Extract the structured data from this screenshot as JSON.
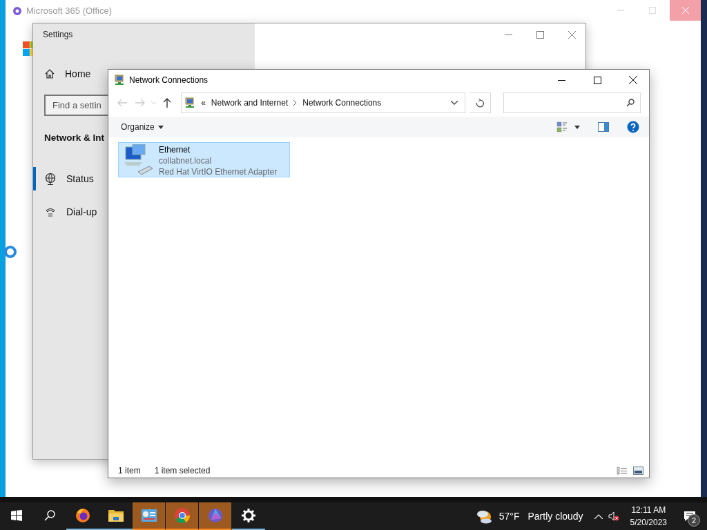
{
  "office_window": {
    "title": "Microsoft 365 (Office)"
  },
  "settings_window": {
    "title": "Settings",
    "home": "Home",
    "search": {
      "placeholder": "Find a settin"
    },
    "section_heading": "Network & Int",
    "nav_items": [
      {
        "kind": "globe",
        "label": "Status",
        "selected": true
      },
      {
        "kind": "phone",
        "label": "Dial-up",
        "selected": false
      }
    ]
  },
  "network_window": {
    "title": "Network Connections",
    "breadcrumb_prefix": "«",
    "breadcrumb": [
      "Network and Internet",
      "Network Connections"
    ],
    "organize": "Organize",
    "items": [
      {
        "name": "Ethernet",
        "domain": "collabnet.local",
        "adapter": "Red Hat VirtIO Ethernet Adapter",
        "selected": true
      }
    ],
    "status_bar": [
      "1 item",
      "1 item selected"
    ]
  },
  "taskbar": {
    "apps": [
      {
        "kind": "firefox",
        "highlighted": false,
        "running": true
      },
      {
        "kind": "explorer",
        "highlighted": false,
        "running": true
      },
      {
        "kind": "control-panel",
        "highlighted": true,
        "running": true
      },
      {
        "kind": "chrome",
        "highlighted": true,
        "running": true
      },
      {
        "kind": "photos",
        "highlighted": true,
        "running": true
      },
      {
        "kind": "settings",
        "highlighted": false,
        "running": true
      }
    ],
    "temperature": "57°F",
    "weather": "Partly cloudy",
    "time": "12:11 AM",
    "date": "5/20/2023",
    "notifications": "2"
  }
}
